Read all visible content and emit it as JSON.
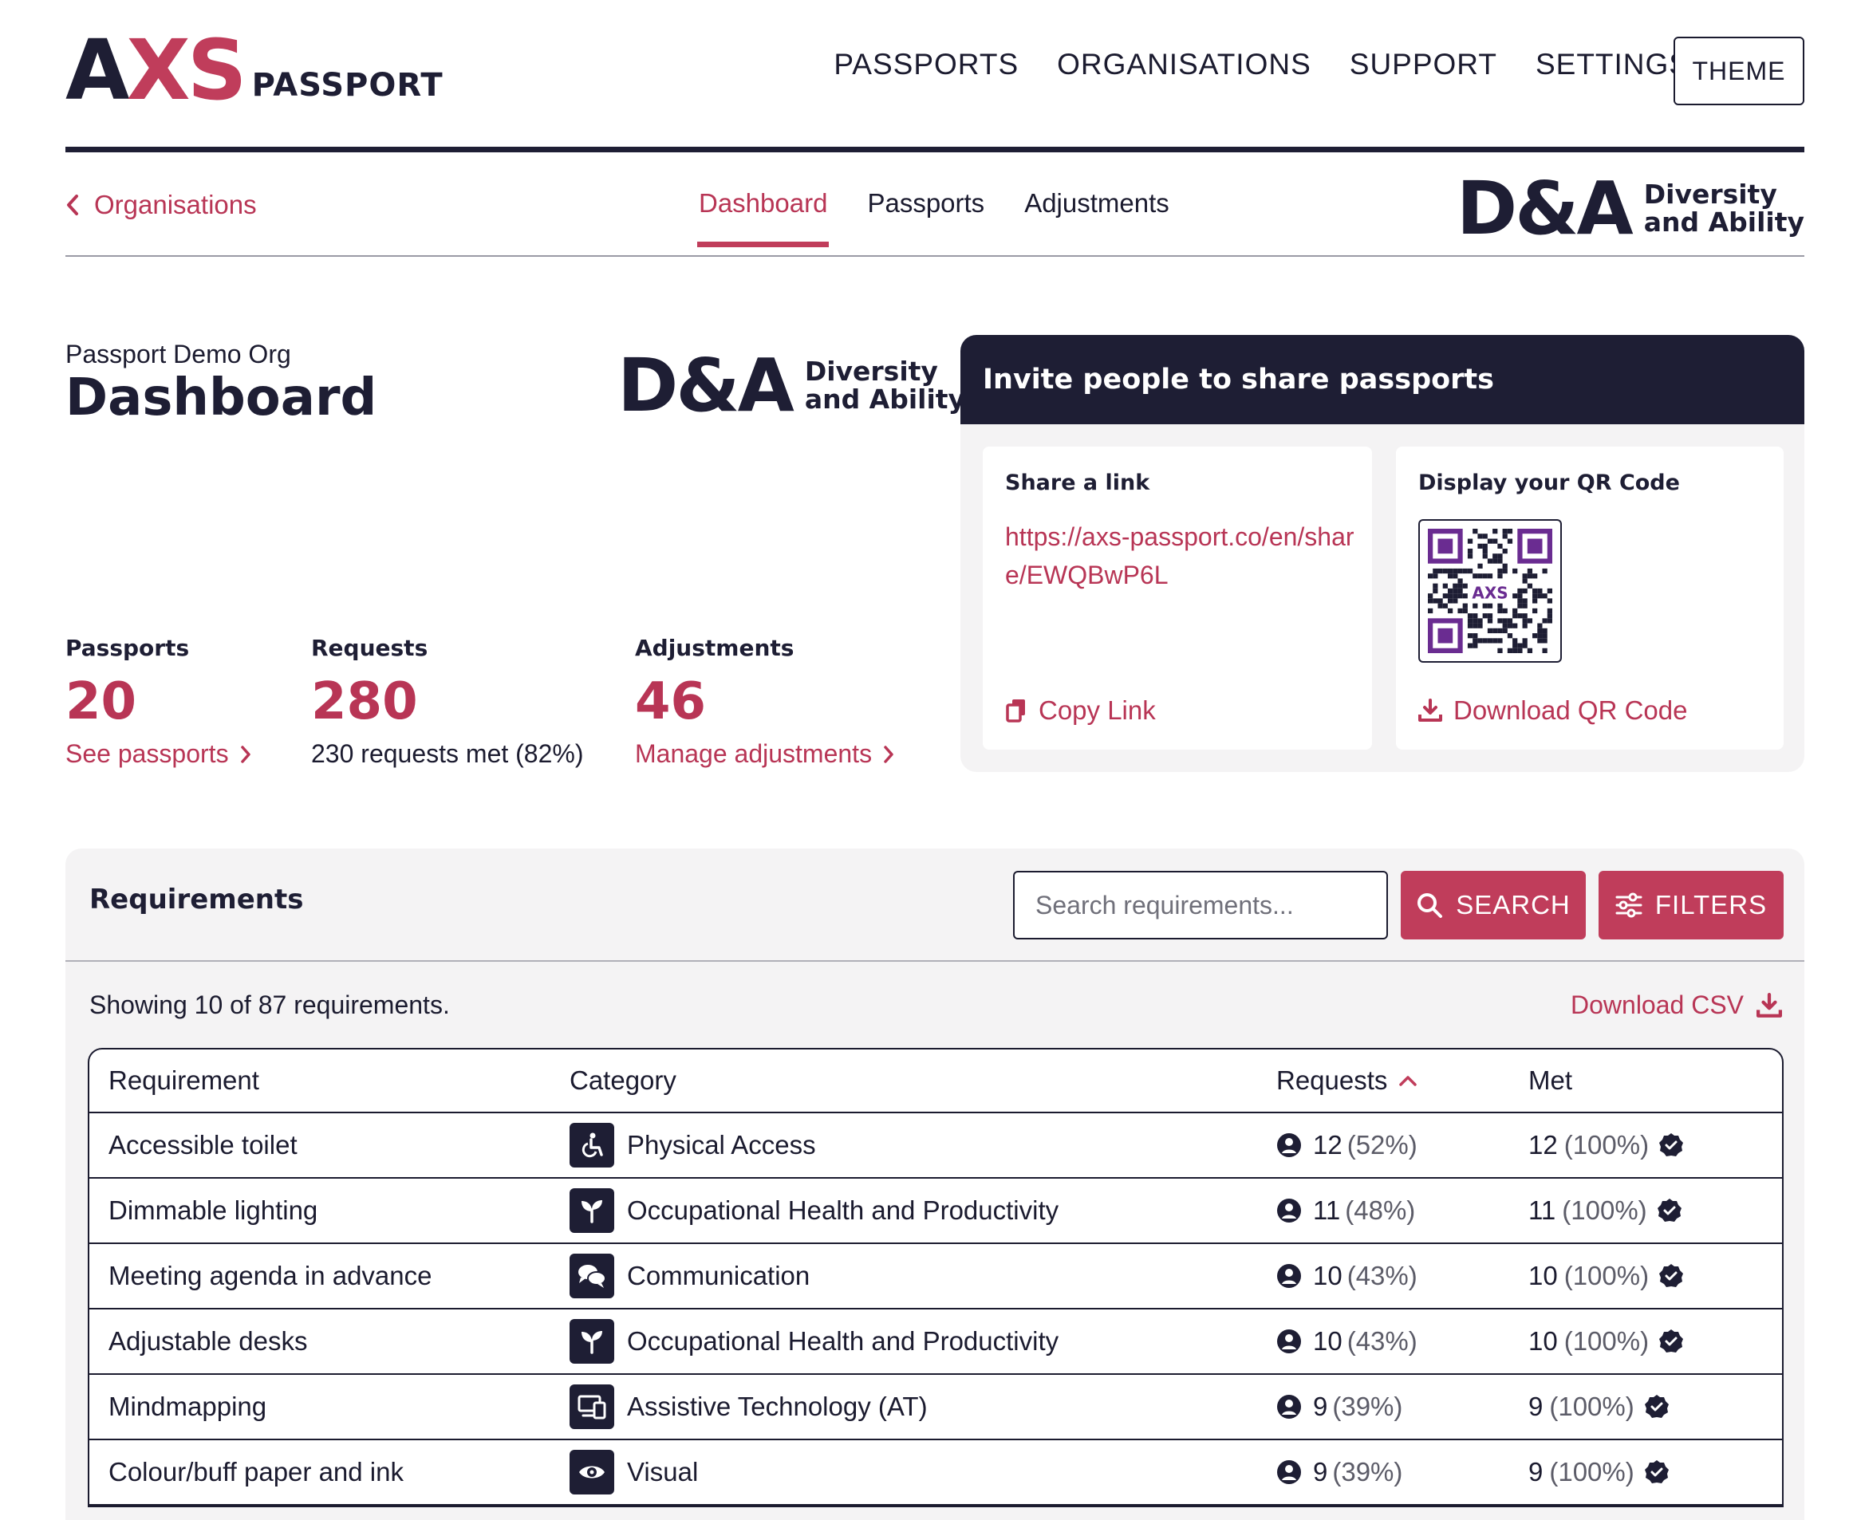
{
  "header": {
    "logo_mark_a": "A",
    "logo_mark_x": "X",
    "logo_mark_s": "S",
    "logo_word": "PASSPORT",
    "nav": [
      "PASSPORTS",
      "ORGANISATIONS",
      "SUPPORT",
      "SETTINGS"
    ],
    "theme_label": "THEME"
  },
  "subnav": {
    "back_label": "Organisations",
    "tabs": [
      "Dashboard",
      "Passports",
      "Adjustments"
    ],
    "active_tab": "Dashboard"
  },
  "org_logo": {
    "mark": "D&A",
    "line1": "Diversity",
    "line2": "and Ability"
  },
  "page": {
    "org_name": "Passport Demo Org",
    "title": "Dashboard"
  },
  "stats": {
    "passports": {
      "label": "Passports",
      "value": "20",
      "link": "See passports"
    },
    "requests": {
      "label": "Requests",
      "value": "280",
      "sub": "230 requests met (82%)"
    },
    "adjustments": {
      "label": "Adjustments",
      "value": "46",
      "link": "Manage adjustments"
    }
  },
  "invite": {
    "title": "Invite people to share passports",
    "share": {
      "heading": "Share a link",
      "url": "https://axs-passport.co/en/share/EWQBwP6L",
      "action": "Copy Link"
    },
    "qr": {
      "heading": "Display your QR Code",
      "center_text": "AXS",
      "action": "Download QR Code"
    }
  },
  "requirements": {
    "title": "Requirements",
    "search_placeholder": "Search requirements...",
    "search_label": "SEARCH",
    "filters_label": "FILTERS",
    "showing": "Showing 10 of 87 requirements.",
    "download_csv": "Download CSV",
    "columns": [
      "Requirement",
      "Category",
      "Requests",
      "Met"
    ],
    "rows": [
      {
        "requirement": "Accessible toilet",
        "icon": "wheelchair-icon",
        "category": "Physical Access",
        "requests": "12",
        "requests_pct": "(52%)",
        "met": "12",
        "met_pct": "(100%)"
      },
      {
        "requirement": "Dimmable lighting",
        "icon": "seedling-icon",
        "category": "Occupational Health and Productivity",
        "requests": "11",
        "requests_pct": "(48%)",
        "met": "11",
        "met_pct": "(100%)"
      },
      {
        "requirement": "Meeting agenda in advance",
        "icon": "chat-bubbles-icon",
        "category": "Communication",
        "requests": "10",
        "requests_pct": "(43%)",
        "met": "10",
        "met_pct": "(100%)"
      },
      {
        "requirement": "Adjustable desks",
        "icon": "seedling-icon",
        "category": "Occupational Health and Productivity",
        "requests": "10",
        "requests_pct": "(43%)",
        "met": "10",
        "met_pct": "(100%)"
      },
      {
        "requirement": "Mindmapping",
        "icon": "devices-icon",
        "category": "Assistive Technology (AT)",
        "requests": "9",
        "requests_pct": "(39%)",
        "met": "9",
        "met_pct": "(100%)"
      },
      {
        "requirement": "Colour/buff paper and ink",
        "icon": "eye-icon",
        "category": "Visual",
        "requests": "9",
        "requests_pct": "(39%)",
        "met": "9",
        "met_pct": "(100%)"
      }
    ]
  },
  "colors": {
    "brand_navy": "#1e1e34",
    "brand_red": "#c03d5b",
    "panel_bg": "#f4f3f4"
  }
}
